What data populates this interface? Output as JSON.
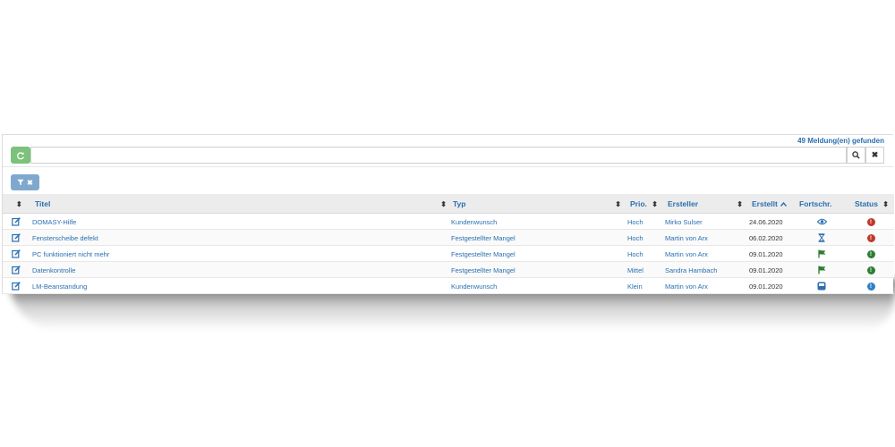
{
  "results": {
    "count_text": "49 Meldung(en) gefunden"
  },
  "search": {
    "value": "",
    "placeholder": ""
  },
  "icons": {
    "refresh": "refresh-icon",
    "search": "search-icon",
    "clear": "close-icon",
    "filter": "filter-icon",
    "sort": "sort-icon",
    "edit": "edit-icon"
  },
  "colors": {
    "link": "#2a6fb0",
    "refresh_button": "#7cc27c",
    "filter_button": "#7fa8cf",
    "status_red": "#c0392b",
    "status_green": "#2e7d32",
    "status_blue": "#2f7fc9",
    "flag_green": "#2e7d32"
  },
  "table": {
    "headers": {
      "titel": "Titel",
      "typ": "Typ",
      "prio": "Prio.",
      "ersteller": "Ersteller",
      "erstellt": "Erstellt",
      "fortschritt": "Fortschr.",
      "status": "Status"
    },
    "rows": [
      {
        "titel": "DOMASY-Hilfe",
        "typ": "Kundenwunsch",
        "prio": "Hoch",
        "ersteller": "Mirko Sulser",
        "erstellt": "24.06.2020",
        "fortschritt": "eye-icon",
        "status": "status-red-icon"
      },
      {
        "titel": "Fensterscheibe defekt",
        "typ": "Festgestellter Mangel",
        "prio": "Hoch",
        "ersteller": "Martin von Arx",
        "erstellt": "06.02.2020",
        "fortschritt": "hourglass-icon",
        "status": "status-red-icon"
      },
      {
        "titel": "PC funktioniert nicht mehr",
        "typ": "Festgestellter Mangel",
        "prio": "Hoch",
        "ersteller": "Martin von Arx",
        "erstellt": "09.01.2020",
        "fortschritt": "flag-icon",
        "status": "status-green-icon"
      },
      {
        "titel": "Datenkontrolle",
        "typ": "Festgestellter Mangel",
        "prio": "Mittel",
        "ersteller": "Sandra Hambach",
        "erstellt": "09.01.2020",
        "fortschritt": "flag-icon",
        "status": "status-green-icon"
      },
      {
        "titel": "LM-Beanstandung",
        "typ": "Kundenwunsch",
        "prio": "Klein",
        "ersteller": "Martin von Arx",
        "erstellt": "09.01.2020",
        "fortschritt": "inbox-icon",
        "status": "status-blue-icon"
      }
    ]
  }
}
